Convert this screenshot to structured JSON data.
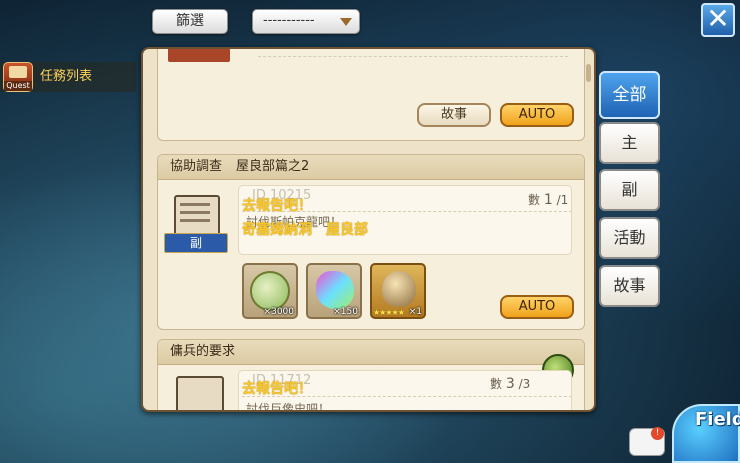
{
  "top": {
    "filter_label": "篩選",
    "dropdown_value": "-----------",
    "close_label": "✕"
  },
  "quest_list": {
    "icon_label": "Quest",
    "label": "任務列表"
  },
  "cards": [
    {
      "buttons": {
        "story": "故事",
        "auto": "AUTO"
      }
    },
    {
      "title": "協助調查",
      "subtitle": "屋良部篇之2",
      "quest_id": "ID 10215",
      "target": "去報告吧！",
      "target_location": "奇塞姆納洞　屋良部",
      "desc": "討伐斯帕克龍吧！",
      "count_label": "數",
      "count_current": "1",
      "count_total": "/1",
      "badge": "副",
      "rewards": [
        {
          "icon": "coin-pouch-icon",
          "qty": "×3000"
        },
        {
          "icon": "crystal-ore-icon",
          "qty": "×150"
        },
        {
          "icon": "pet-egg-icon",
          "qty": "×1",
          "stars": "★★★★★"
        }
      ],
      "auto": "AUTO"
    },
    {
      "title": "傭兵的要求",
      "quest_id": "ID 11712",
      "target": "去報告吧！",
      "desc": "討伐巨像史吧！",
      "count_label": "數",
      "count_current": "3",
      "count_total": "/3"
    }
  ],
  "tabs": [
    "全部",
    "主",
    "副",
    "活動",
    "故事"
  ],
  "field_label": "Field",
  "chat_badge": "!",
  "colors": {
    "accent": "#1f63b4",
    "auto": "#f0a21a",
    "target": "#f7c62a"
  }
}
